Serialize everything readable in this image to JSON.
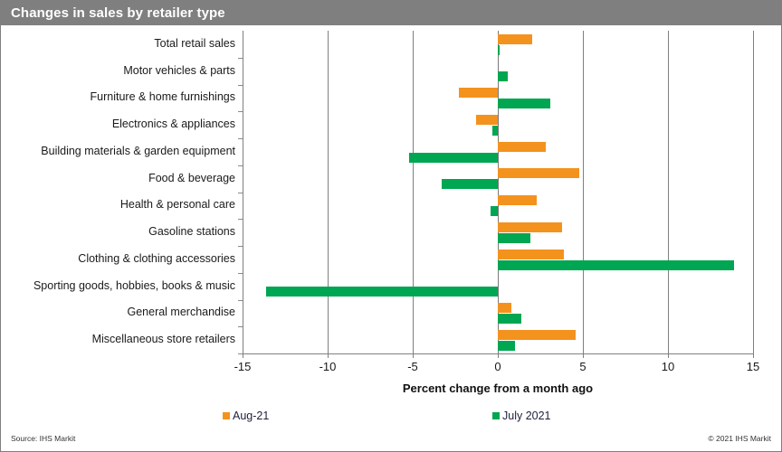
{
  "header": {
    "title": "Changes in sales by retailer type"
  },
  "footer": {
    "source": "Source: IHS Markit",
    "copyright": "© 2021  IHS Markit"
  },
  "legend": {
    "position": "bottom",
    "entries": [
      {
        "label": "Aug-21",
        "color": "#F4921E"
      },
      {
        "label": "July 2021",
        "color": "#00A651"
      }
    ]
  },
  "colors": {
    "aug_21": "#F4921E",
    "july_2021": "#00A651",
    "title_bar": "#7F7F7F",
    "axis": "#808080",
    "card_border": "#7F7F7F"
  },
  "chart_data": {
    "type": "bar",
    "orientation": "horizontal",
    "title": "Changes in sales by retailer type",
    "subtitle": "",
    "xlabel": "Percent change from a month ago",
    "ylabel": "",
    "xlim": [
      -15,
      15
    ],
    "xticks": [
      -15,
      -10,
      -5,
      0,
      5,
      10,
      15
    ],
    "xtick_labels": [
      "-15",
      "-10",
      "-5",
      "0",
      "5",
      "10",
      "15"
    ],
    "grid": true,
    "grid_axis": "x",
    "categories": [
      "Total retail sales",
      "Motor vehicles & parts",
      "Furniture & home furnishings",
      "Electronics & appliances",
      "Building materials & garden equipment",
      "Food & beverage",
      "Health & personal care",
      "Gasoline stations",
      "Clothing & clothing accessories",
      "Sporting goods, hobbies, books & music",
      "General merchandise",
      "Miscellaneous store retailers"
    ],
    "series": [
      {
        "name": "Aug-21",
        "color": "#F4921E",
        "values": [
          2.0,
          0.0,
          -2.3,
          -1.3,
          2.8,
          4.8,
          2.3,
          3.8,
          3.9,
          0.0,
          0.8,
          4.6
        ]
      },
      {
        "name": "July 2021",
        "color": "#00A651",
        "values": [
          0.1,
          0.6,
          3.1,
          -0.3,
          -5.2,
          -3.3,
          -0.4,
          1.9,
          13.9,
          -13.6,
          1.4,
          1.0
        ]
      }
    ]
  }
}
